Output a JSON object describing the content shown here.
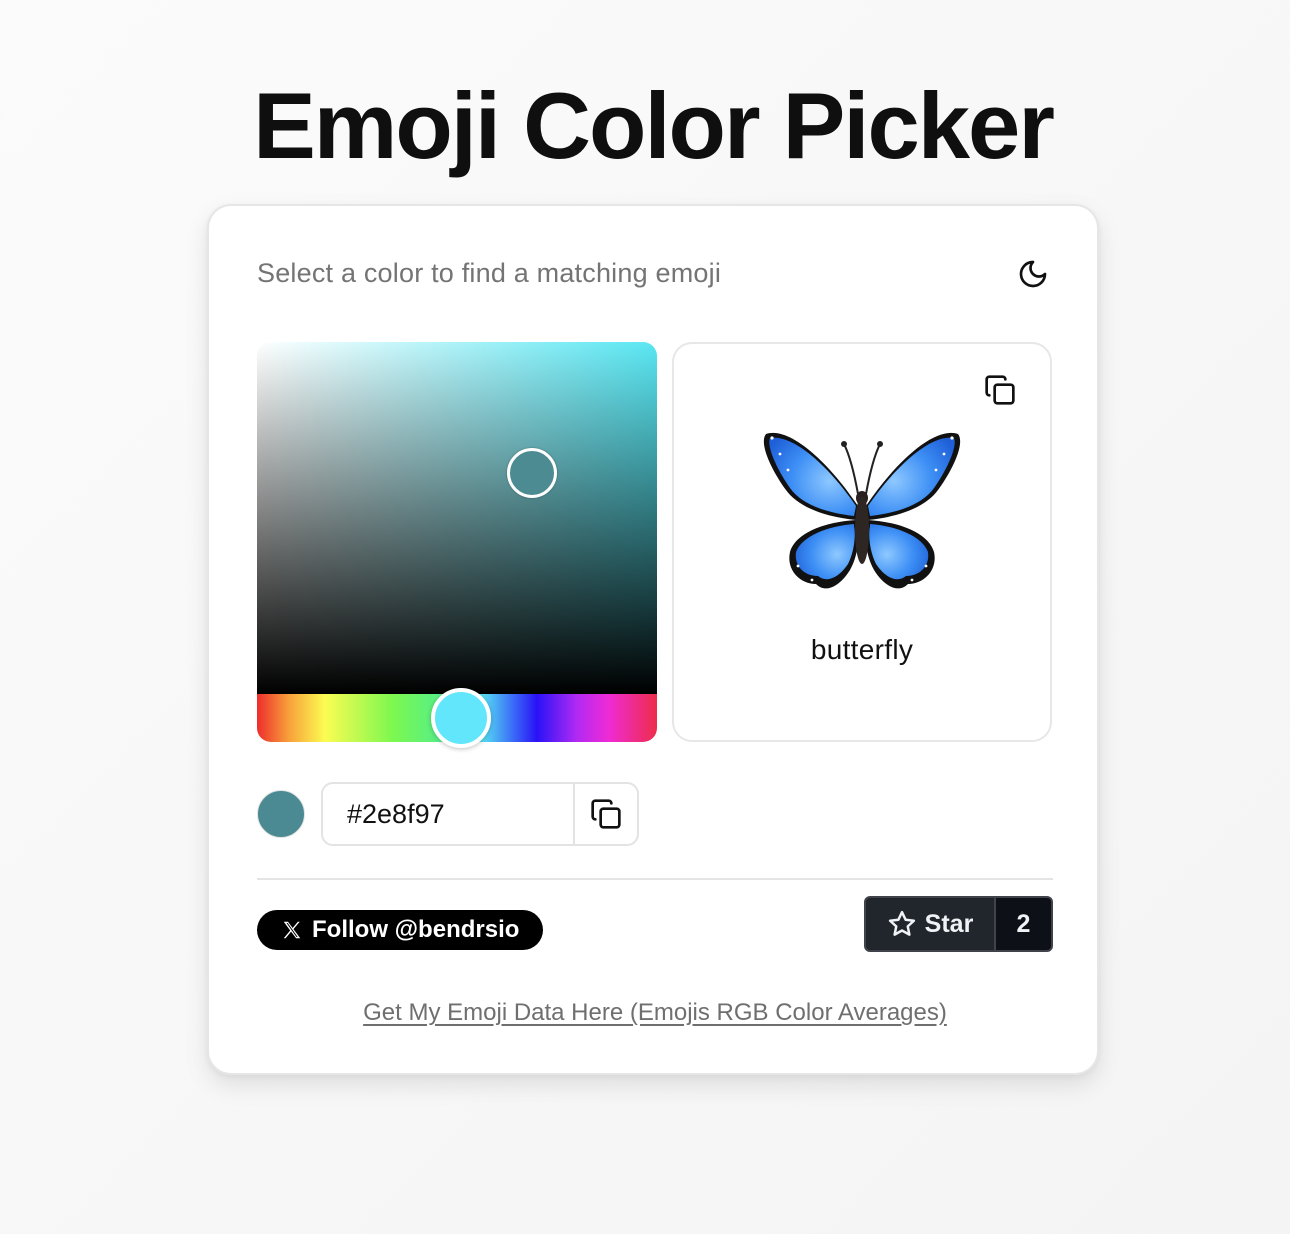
{
  "title": "Emoji Color Picker",
  "picker": {
    "subtitle": "Select a color to find a matching emoji",
    "theme_toggle_icon": "moon-icon",
    "hue_color": "#59e7f3",
    "handle_color": "#62e6fb",
    "sv_handle_color": "#4c8b92"
  },
  "emoji": {
    "name": "butterfly",
    "copy_icon": "copy-icon",
    "image_icon": "butterfly-icon"
  },
  "color_input": {
    "value": "#2e8f97",
    "swatch_color": "#4b8a92",
    "copy_icon": "copy-icon"
  },
  "footer": {
    "follow_label": "Follow @bendrsio",
    "follow_icon": "x-logo-icon",
    "star_label": "Star",
    "star_icon": "star-icon",
    "star_count": "2",
    "data_link": "Get My Emoji Data Here (Emojis RGB Color Averages)"
  }
}
